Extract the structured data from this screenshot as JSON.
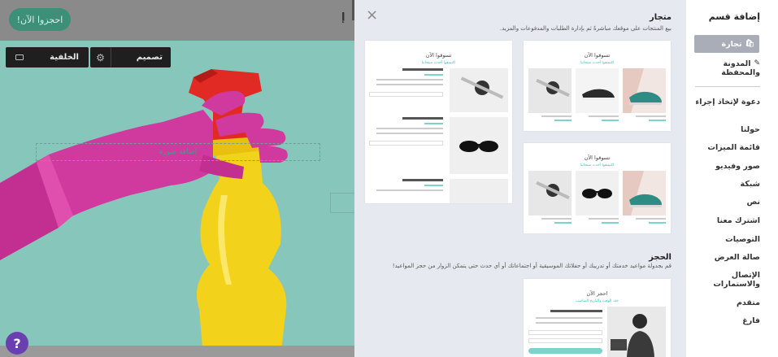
{
  "canvas": {
    "cta_label": "احجزوا الآن!",
    "logo_text": "إ",
    "background_button": "الخلفية",
    "design_button": "تصميم",
    "design_badge": "D",
    "add_image_label": "إضافة صورة",
    "help_label": "?",
    "colors": {
      "hero": "#87c6bb",
      "glove": "#d0399e",
      "bottle": "#f2d21a",
      "nozzle": "#e02a23"
    }
  },
  "gallery": {
    "close_label": "×",
    "sections": [
      {
        "title": "متجار",
        "description": "بيع المنتجات على موقعك مباشرةً ثم بإدارة الطلبات والمدفوعات والمزيد.",
        "cards": [
          {
            "heading": "تسوقوا الآن",
            "sub": "اكتشفوا أحدث منتجاتنا"
          },
          {
            "heading": "تسوقوا الآن",
            "sub": "اكتشفوا أحدث منتجاتنا"
          },
          {
            "heading": "تسوقوا الآن",
            "sub": "اكتشفوا أحدث منتجاتنا"
          }
        ]
      },
      {
        "title": "الحجز",
        "description": "قم بجدولة مواعيد خدمتك أو تدريبك أو حفلاتك الموسيقية أو اجتماعاتك أو أي حدث حتى يتمكن الزوار من حجز المواعيد!",
        "cards": [
          {
            "heading": "احجز الآن",
            "sub": "حدد الوقت والتاريخ المناسب"
          }
        ]
      }
    ]
  },
  "menu": {
    "title": "إضافة قسم",
    "items": [
      {
        "label": "تجارة",
        "icon": "bag-icon",
        "active": true
      },
      {
        "label": "المدونة والمحفظة",
        "icon": "edit-icon",
        "active": false
      },
      {
        "label": "دعوة لإتخاذ إجراء",
        "active": false
      },
      {
        "label": "حولنا",
        "active": false
      },
      {
        "label": "قائمة الميزات",
        "active": false
      },
      {
        "label": "صور وفيديو",
        "active": false
      },
      {
        "label": "شبكة",
        "active": false
      },
      {
        "label": "نص",
        "active": false
      },
      {
        "label": "اشترك معنا",
        "active": false
      },
      {
        "label": "التوصيات",
        "active": false
      },
      {
        "label": "صالة العرض",
        "active": false
      },
      {
        "label": "الإتصال والاستمارات",
        "active": false
      },
      {
        "label": "متقدم",
        "active": false
      },
      {
        "label": "فارغ",
        "active": false
      }
    ]
  }
}
